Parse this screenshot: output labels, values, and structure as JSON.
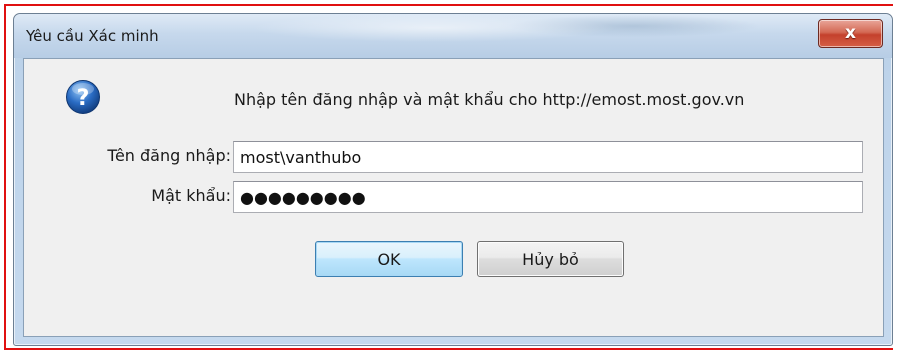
{
  "window": {
    "title": "Yêu cầu Xác minh",
    "close_symbol": "x"
  },
  "dialog": {
    "icon": "question-mark-icon",
    "message": "Nhập tên đăng nhập và mật khẩu cho http://emost.most.gov.vn",
    "username_label": "Tên đăng nhập:",
    "username_value": "most\\vanthubo",
    "password_label": "Mật khẩu:",
    "password_value": "●●●●●●●●●",
    "ok_label": "OK",
    "cancel_label": "Hủy bỏ"
  },
  "colors": {
    "frame_highlight": "#e01010",
    "help_icon_blue": "#2a6cc4",
    "close_button_red": "#c4412c",
    "default_button_border": "#3c7fb1"
  }
}
